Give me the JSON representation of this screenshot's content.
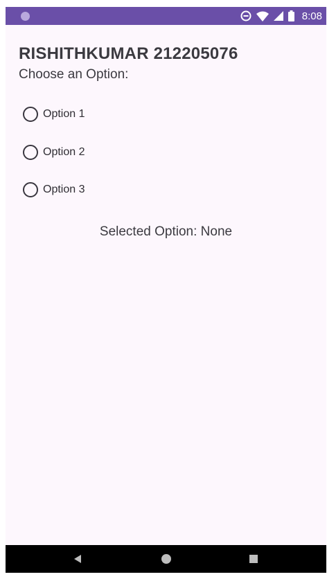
{
  "status_bar": {
    "time": "8:08",
    "icons": [
      "notification-dot-icon",
      "do-not-disturb-icon",
      "wifi-icon",
      "signal-icon",
      "battery-icon"
    ],
    "background": "#6a4fa8"
  },
  "header": {
    "title": "RISHITHKUMAR 212205076",
    "subtitle": "Choose an Option:"
  },
  "options": [
    {
      "label": "Option 1",
      "selected": false
    },
    {
      "label": "Option 2",
      "selected": false
    },
    {
      "label": "Option 3",
      "selected": false
    }
  ],
  "result": {
    "text": "Selected Option: None"
  },
  "nav_bar": {
    "buttons": [
      "back-icon",
      "home-icon",
      "recents-icon"
    ]
  },
  "colors": {
    "background": "#fdf7fd",
    "text": "#3b3a40",
    "radio": "#39363f"
  }
}
